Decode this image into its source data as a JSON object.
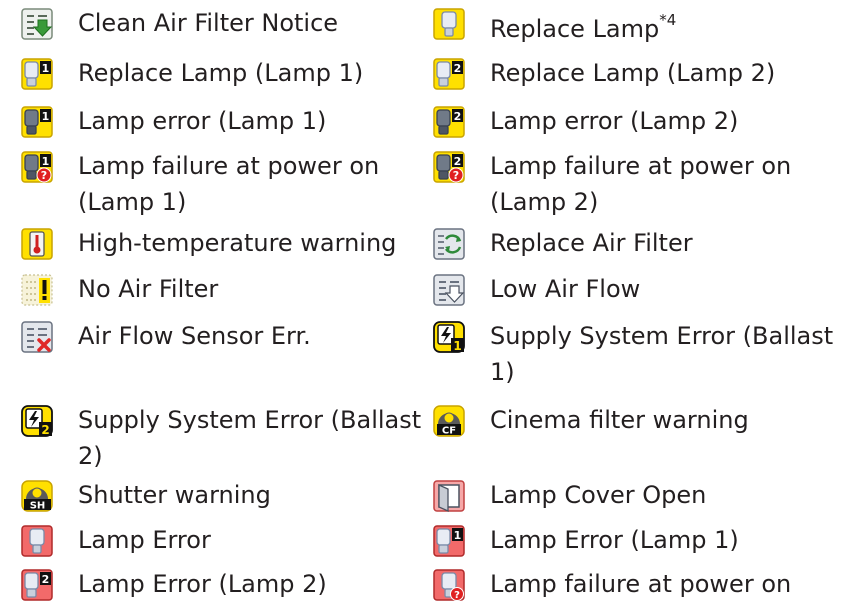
{
  "items": [
    {
      "label": "Clean Air Filter Notice",
      "icon": "clean-air-filter-notice-icon"
    },
    {
      "label": "Replace Lamp",
      "sup": "*4",
      "icon": "replace-lamp-icon"
    },
    {
      "label": "Replace Lamp (Lamp 1)",
      "icon": "replace-lamp-1-icon"
    },
    {
      "label": "Replace Lamp (Lamp 2)",
      "icon": "replace-lamp-2-icon"
    },
    {
      "label": "Lamp error (Lamp 1)",
      "icon": "lamp-error-1-icon"
    },
    {
      "label": "Lamp error (Lamp 2)",
      "icon": "lamp-error-2-icon"
    },
    {
      "label": "Lamp failure at power on",
      "label2": "(Lamp 1)",
      "icon": "lamp-failure-power-on-1-icon"
    },
    {
      "label": "Lamp failure at power on",
      "label2": "(Lamp 2)",
      "icon": "lamp-failure-power-on-2-icon"
    },
    {
      "label": "High-temperature warning",
      "icon": "high-temperature-icon"
    },
    {
      "label": "Replace Air Filter",
      "icon": "replace-air-filter-icon"
    },
    {
      "label": "No Air Filter",
      "icon": "no-air-filter-icon"
    },
    {
      "label": "Low Air Flow",
      "icon": "low-air-flow-icon"
    },
    {
      "label": "Air Flow Sensor Err.",
      "icon": "air-flow-sensor-error-icon"
    },
    {
      "label": "Supply System Error (Ballast",
      "label2": "1)",
      "icon": "supply-system-error-1-icon"
    },
    {
      "label": "Supply System Error (Ballast",
      "label2": "2)",
      "icon": "supply-system-error-2-icon"
    },
    {
      "label": "Cinema filter warning",
      "icon": "cinema-filter-warning-icon"
    },
    {
      "label": "Shutter warning",
      "icon": "shutter-warning-icon"
    },
    {
      "label": "Lamp Cover Open",
      "icon": "lamp-cover-open-icon"
    },
    {
      "label": "Lamp Error",
      "icon": "lamp-error-icon"
    },
    {
      "label": "Lamp Error (Lamp 1)",
      "icon": "lamp-error-red-1-icon"
    },
    {
      "label": "Lamp Error (Lamp 2)",
      "icon": "lamp-error-red-2-icon"
    },
    {
      "label": "Lamp failure at power on",
      "icon": "lamp-failure-power-on-icon"
    }
  ]
}
